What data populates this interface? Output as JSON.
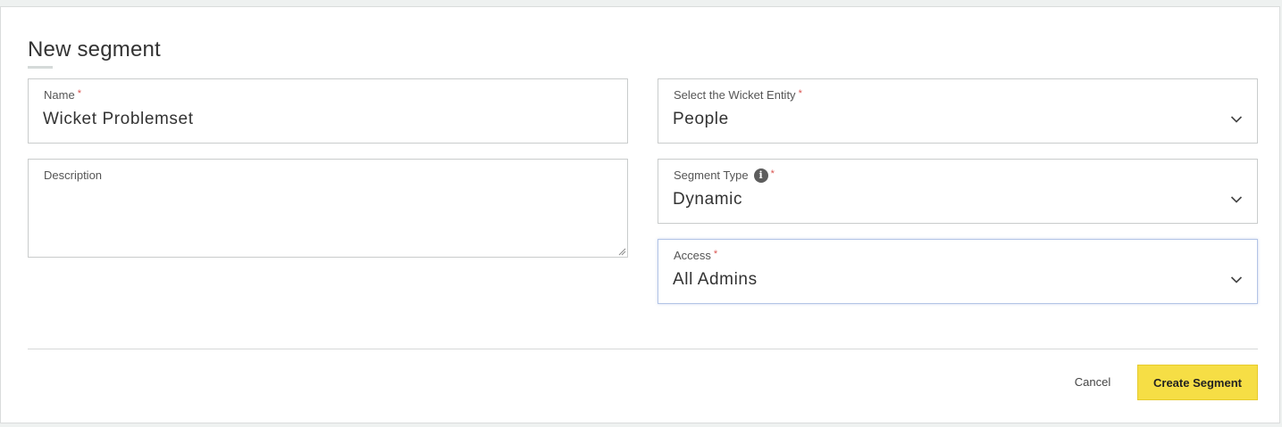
{
  "form": {
    "title": "New segment",
    "name": {
      "label": "Name",
      "required_mark": "*",
      "value": "Wicket Problemset"
    },
    "description": {
      "label": "Description",
      "value": ""
    },
    "entity": {
      "label": "Select the Wicket Entity",
      "required_mark": "*",
      "value": "People"
    },
    "segment_type": {
      "label": "Segment Type",
      "info_glyph": "i",
      "required_mark": "*",
      "value": "Dynamic"
    },
    "access": {
      "label": "Access",
      "required_mark": "*",
      "value": "All Admins"
    }
  },
  "footer": {
    "cancel_label": "Cancel",
    "create_label": "Create Segment"
  },
  "icons": {
    "dropdown": "chevron-down-icon",
    "info": "info-icon",
    "resize": "resize-grip-icon"
  },
  "colors": {
    "primary_button": "#f6de45",
    "required": "#d9534f",
    "focus_border": "#b3c4e6"
  }
}
